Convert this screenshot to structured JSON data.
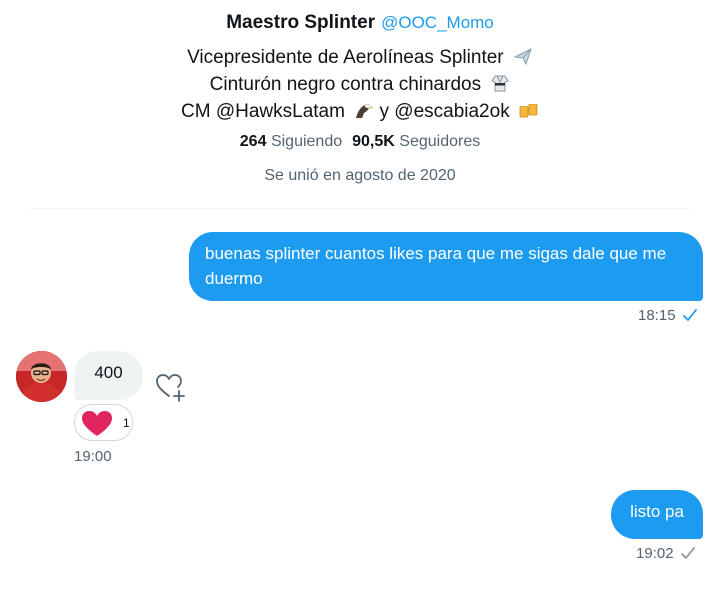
{
  "profile": {
    "display_name": "Maestro Splinter",
    "handle": "@OOC_Momo",
    "bio_lines": [
      {
        "text": "Vicepresidente de Aerolíneas Splinter",
        "emoji": "airplane-emoji"
      },
      {
        "text": "Cinturón negro contra chinardos",
        "emoji": "martial-arts-uniform-emoji"
      },
      {
        "text_a": "CM @HawksLatam",
        "emoji_a": "eagle-emoji",
        "text_b": "y @escabia2ok",
        "emoji_b": "beer-mugs-emoji"
      }
    ],
    "following_count": "264",
    "following_label": "Siguiendo",
    "followers_count": "90,5K",
    "followers_label": "Seguidores",
    "joined": "Se unió en agosto de 2020"
  },
  "messages": [
    {
      "direction": "outgoing",
      "text": "buenas splinter cuantos likes para que me sigas dale que me duermo",
      "time": "18:15",
      "status_icon": "read-check-icon",
      "status_color": "#1d9bf0"
    },
    {
      "direction": "incoming",
      "text": "400",
      "time": "19:00",
      "reaction": {
        "icon": "heart-icon",
        "count": "1"
      }
    },
    {
      "direction": "outgoing",
      "text": "listo pa",
      "time": "19:02",
      "status_icon": "sent-check-icon",
      "status_color": "#8b98a5"
    }
  ],
  "colors": {
    "accent": "#1d9bf0",
    "bubble_in": "#eff3f4",
    "muted": "#536471",
    "heart": "#e0245e"
  }
}
